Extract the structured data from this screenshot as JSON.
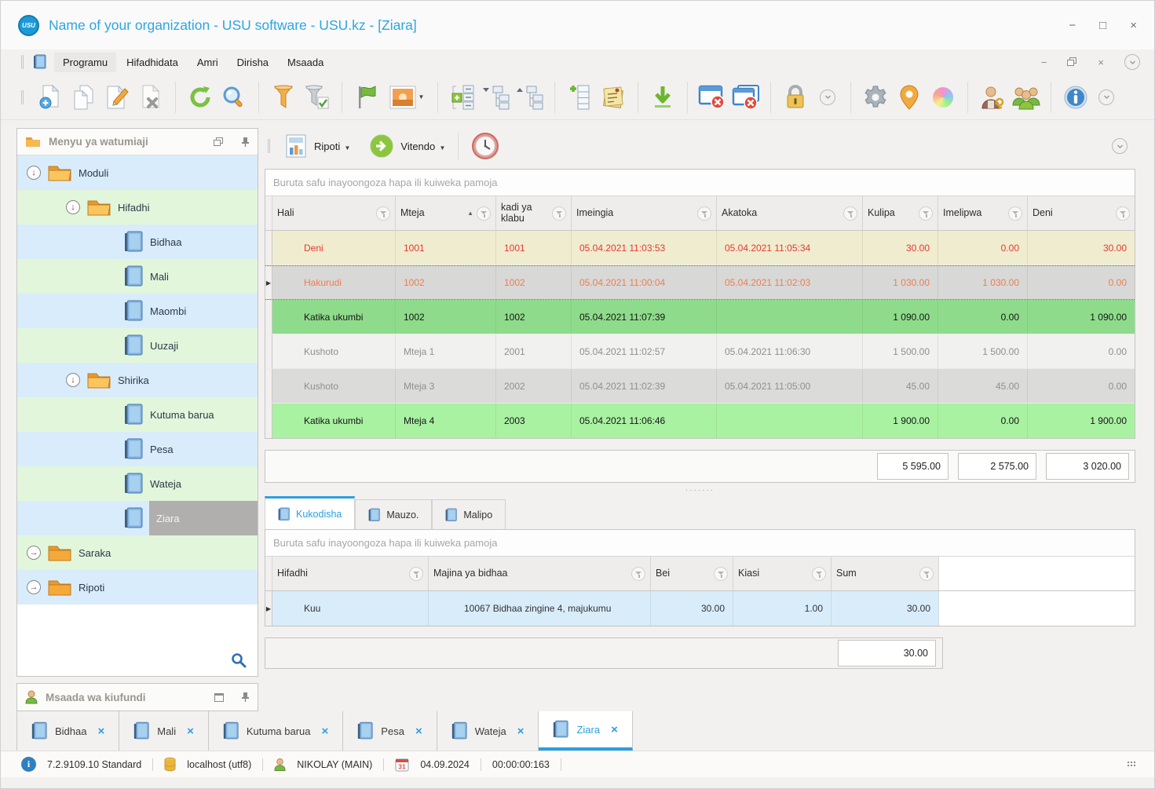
{
  "window": {
    "title": "Name of your organization - USU software - USU.kz - [Ziara]",
    "logo_text": "USU"
  },
  "menu": {
    "items": [
      "Programu",
      "Hifadhidata",
      "Amri",
      "Dirisha",
      "Msaada"
    ]
  },
  "toolbar": {
    "icons": [
      "new-record",
      "copy-record",
      "edit-record",
      "delete-record",
      "refresh",
      "search",
      "filter",
      "filter-check",
      "flag",
      "image",
      "expand-rows",
      "tree-expand",
      "tree-collapse",
      "add-row",
      "notes",
      "export-down",
      "close-window",
      "close-all-windows",
      "lock",
      "overflow-chevron",
      "settings-gear",
      "location-pin",
      "color-palette",
      "user-key",
      "users-group",
      "info",
      "overflow-chevron-2"
    ]
  },
  "actionbar": {
    "ripoti_label": "Ripoti",
    "vitendo_label": "Vitendo"
  },
  "sidebar": {
    "menu_panel_title": "Menyu ya watumiaji",
    "help_panel_title": "Msaada wa kiufundi",
    "tree": [
      {
        "label": "Moduli"
      },
      {
        "label": "Hifadhi"
      },
      {
        "label": "Bidhaa"
      },
      {
        "label": "Mali"
      },
      {
        "label": "Maombi"
      },
      {
        "label": "Uuzaji"
      },
      {
        "label": "Shirika"
      },
      {
        "label": "Kutuma barua"
      },
      {
        "label": "Pesa"
      },
      {
        "label": "Wateja"
      },
      {
        "label": "Ziara"
      },
      {
        "label": "Saraka"
      },
      {
        "label": "Ripoti"
      }
    ]
  },
  "main": {
    "groupby_hint": "Buruta safu inayoongoza hapa ili kuiweka pamoja",
    "grid": {
      "columns": [
        "Hali",
        "Mteja",
        "kadi ya klabu",
        "Imeingia",
        "Akatoka",
        "Kulipa",
        "Imelipwa",
        "Deni"
      ],
      "rows": [
        {
          "hali": "Deni",
          "mteja": "1001",
          "kadi": "1001",
          "imeingia": "05.04.2021 11:03:53",
          "akatoka": "05.04.2021 11:05:34",
          "kulipa": "30.00",
          "imelipwa": "0.00",
          "deni": "30.00"
        },
        {
          "hali": "Hakurudi",
          "mteja": "1002",
          "kadi": "1002",
          "imeingia": "05.04.2021 11:00:04",
          "akatoka": "05.04.2021 11:02:03",
          "kulipa": "1 030.00",
          "imelipwa": "1 030.00",
          "deni": "0.00"
        },
        {
          "hali": "Katika ukumbi",
          "mteja": "1002",
          "kadi": "1002",
          "imeingia": "05.04.2021 11:07:39",
          "akatoka": "",
          "kulipa": "1 090.00",
          "imelipwa": "0.00",
          "deni": "1 090.00"
        },
        {
          "hali": "Kushoto",
          "mteja": "Mteja 1",
          "kadi": "2001",
          "imeingia": "05.04.2021 11:02:57",
          "akatoka": "05.04.2021 11:06:30",
          "kulipa": "1 500.00",
          "imelipwa": "1 500.00",
          "deni": "0.00"
        },
        {
          "hali": "Kushoto",
          "mteja": "Mteja 3",
          "kadi": "2002",
          "imeingia": "05.04.2021 11:02:39",
          "akatoka": "05.04.2021 11:05:00",
          "kulipa": "45.00",
          "imelipwa": "45.00",
          "deni": "0.00"
        },
        {
          "hali": "Katika ukumbi",
          "mteja": "Mteja 4",
          "kadi": "2003",
          "imeingia": "05.04.2021 11:06:46",
          "akatoka": "",
          "kulipa": "1 900.00",
          "imelipwa": "0.00",
          "deni": "1 900.00"
        }
      ],
      "totals": {
        "kulipa": "5 595.00",
        "imelipwa": "2 575.00",
        "deni": "3 020.00"
      }
    },
    "detail": {
      "tabs": [
        "Kukodisha",
        "Mauzo.",
        "Malipo"
      ],
      "groupby_hint": "Buruta safu inayoongoza hapa ili kuiweka pamoja",
      "columns": [
        "Hifadhi",
        "Majina ya bidhaa",
        "Bei",
        "Kiasi",
        "Sum"
      ],
      "rows": [
        {
          "hifadhi": "Kuu",
          "majina": "10067 Bidhaa zingine 4, majukumu",
          "bei": "30.00",
          "kiasi": "1.00",
          "sum": "30.00"
        }
      ],
      "total_sum": "30.00"
    }
  },
  "window_tabs": [
    {
      "label": "Bidhaa"
    },
    {
      "label": "Mali"
    },
    {
      "label": "Kutuma barua"
    },
    {
      "label": "Pesa"
    },
    {
      "label": "Wateja"
    },
    {
      "label": "Ziara"
    }
  ],
  "statusbar": {
    "version": "7.2.9109.10 Standard",
    "database": "localhost (utf8)",
    "user": "NIKOLAY (MAIN)",
    "calendar_icon_day": "31",
    "date": "04.09.2024",
    "timer": "00:00:00:163"
  },
  "colors": {
    "accent_blue": "#2b9fe0",
    "title_blue": "#2aa7e1",
    "row_debt_bg": "#f0ecd0",
    "row_debt_text": "#e4392e",
    "row_selected_bg": "#d8d8d7",
    "row_selected_text": "#ee7d52",
    "row_inhall_bg": "#8edc8b",
    "row_inhall_alt_bg": "#a9f2a2",
    "row_left_bg": "#f1f1ef",
    "row_left_alt_bg": "#dbdbd9",
    "tree_row_blue": "#d9ecfb",
    "tree_row_green": "#e2f6dc",
    "detail_row_blue": "#d8ecfa"
  }
}
